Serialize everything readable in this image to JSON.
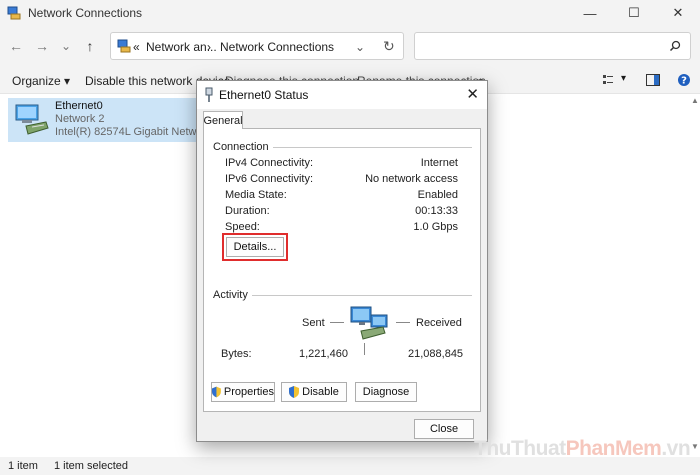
{
  "window": {
    "title": "Network Connections",
    "controls": {
      "minimize": "—",
      "maximize": "☐",
      "close": "✕"
    }
  },
  "address": {
    "back": "←",
    "forward": "→",
    "history": "⌄",
    "up": "↑",
    "overflow": "«",
    "crumb1": "Network an...",
    "separator": "›",
    "crumb2": "Network Connections",
    "dropdown": "⌄",
    "refresh": "↻",
    "search_value": ""
  },
  "commandbar": {
    "organize": "Organize",
    "disable": "Disable this network device",
    "diagnose": "Diagnose this connection",
    "rename": "Rename this connection",
    "more": "»"
  },
  "item": {
    "name": "Ethernet0",
    "network": "Network 2",
    "adapter": "Intel(R) 82574L Gigabit Network C"
  },
  "statusbar": {
    "count": "1 item",
    "selected": "1 item selected"
  },
  "dialog": {
    "title": "Ethernet0 Status",
    "close": "✕",
    "tab": "General",
    "connection": {
      "label": "Connection",
      "rows": [
        {
          "label": "IPv4 Connectivity:",
          "value": "Internet"
        },
        {
          "label": "IPv6 Connectivity:",
          "value": "No network access"
        },
        {
          "label": "Media State:",
          "value": "Enabled"
        },
        {
          "label": "Duration:",
          "value": "00:13:33"
        },
        {
          "label": "Speed:",
          "value": "1.0 Gbps"
        }
      ],
      "details_button": "Details..."
    },
    "activity": {
      "label": "Activity",
      "sent": "Sent",
      "received": "Received",
      "bytes_label": "Bytes:",
      "bytes_sent": "1,221,460",
      "bytes_received": "21,088,845"
    },
    "buttons": {
      "properties": "Properties",
      "disable": "Disable",
      "diagnose": "Diagnose",
      "close": "Close"
    }
  },
  "watermark": {
    "part1": "ThuThuat",
    "part2": "PhanMem",
    "part3": ".vn"
  },
  "colors": {
    "accent_selection": "#cce4f7",
    "highlight_border": "#e02d2d"
  }
}
